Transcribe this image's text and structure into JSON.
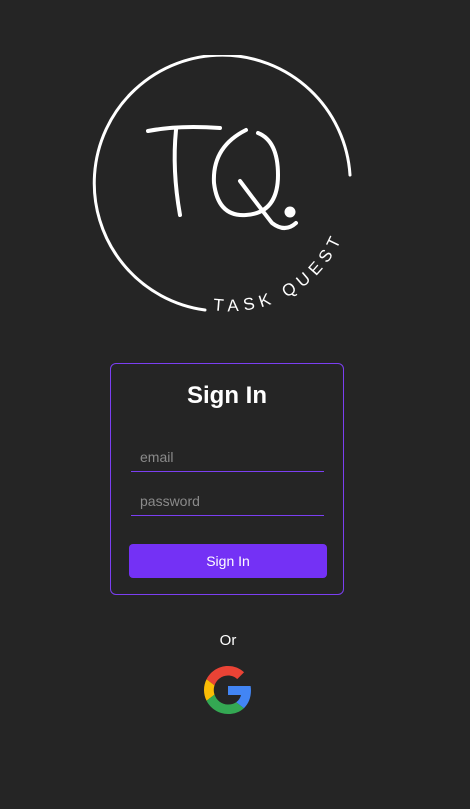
{
  "logo": {
    "monogram": "TQ",
    "tagline": "TASK QUEST"
  },
  "signin": {
    "title": "Sign In",
    "email_placeholder": "email",
    "email_value": "",
    "password_placeholder": "password",
    "password_value": "",
    "submit_label": "Sign In"
  },
  "alt": {
    "or_label": "Or",
    "google_icon": "google-icon"
  },
  "colors": {
    "background": "#252525",
    "accent": "#7431f5",
    "border": "#7b3ff2",
    "text": "#ffffff"
  }
}
